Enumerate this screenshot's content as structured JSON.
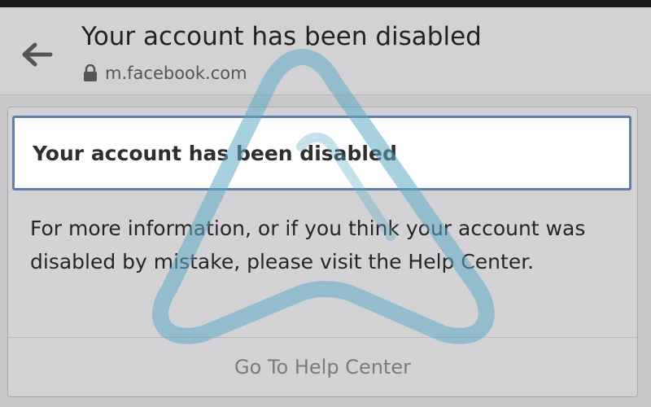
{
  "header": {
    "title": "Your account has been disabled",
    "url": "m.facebook.com"
  },
  "card": {
    "title": "Your account has been disabled",
    "body": "For more information, or if you think your account was disabled by mistake, please visit the Help Center.",
    "link_label": "Go To Help Center"
  },
  "icons": {
    "back": "arrow-left-icon",
    "lock": "lock-icon",
    "watermark": "triangle-watermark"
  },
  "colors": {
    "title_box_border": "#5f7fa9",
    "watermark": "#5fa9c4"
  }
}
